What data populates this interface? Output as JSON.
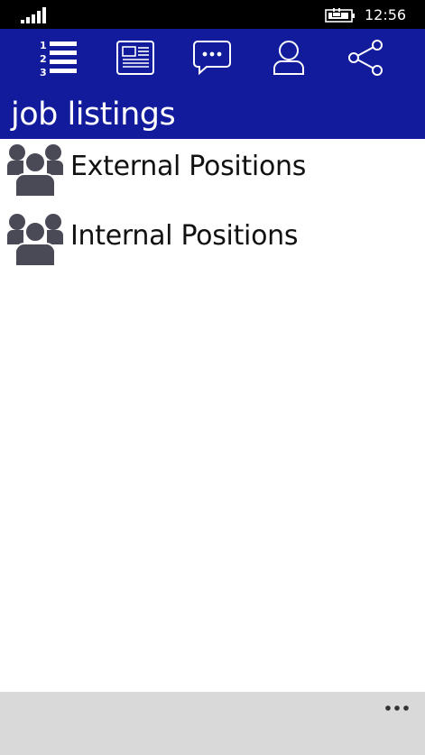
{
  "status_bar": {
    "time": "12:56",
    "signal_icon": "signal-bars-icon",
    "battery_icon": "battery-charging-icon"
  },
  "nav": {
    "tabs": [
      {
        "icon": "numbered-list-icon",
        "selected": true
      },
      {
        "icon": "newspaper-icon",
        "selected": false
      },
      {
        "icon": "chat-bubble-icon",
        "selected": false
      },
      {
        "icon": "person-icon",
        "selected": false
      },
      {
        "icon": "share-icon",
        "selected": false
      }
    ]
  },
  "page": {
    "title": "job listings"
  },
  "list": {
    "items": [
      {
        "label": "External Positions",
        "icon": "people-group-icon"
      },
      {
        "label": "Internal Positions",
        "icon": "people-group-icon"
      }
    ]
  },
  "app_bar": {
    "more_icon": "ellipsis-icon"
  },
  "colors": {
    "header": "#111b9b",
    "app_bar": "#d9d9d9",
    "icon_dark": "#4a4a57"
  }
}
